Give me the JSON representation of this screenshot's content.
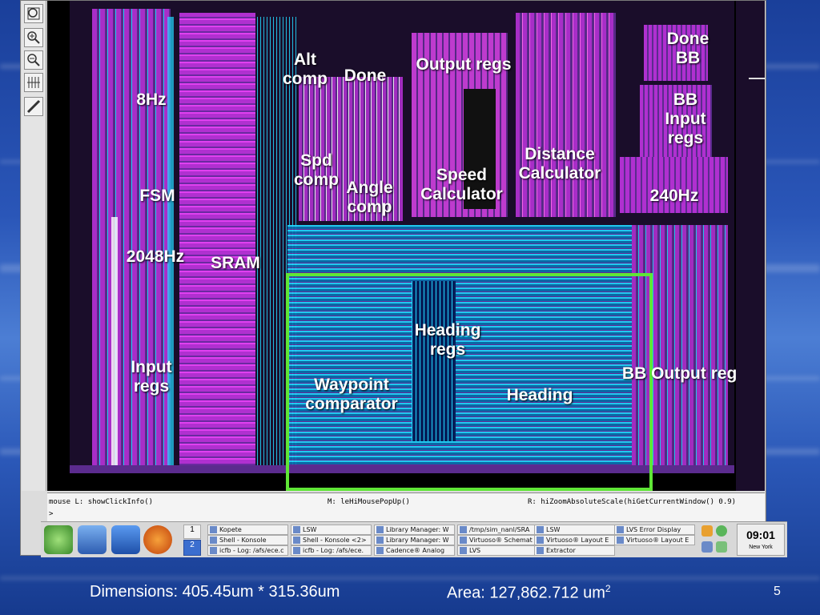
{
  "colors": {
    "magenta": "#b030d0",
    "purple": "#5b2b8e",
    "cyan": "#22d8ff",
    "green_box": "#5fe636"
  },
  "toolbar": {
    "icons": [
      "zoom-fit-icon",
      "zoom-in-icon",
      "zoom-out-icon",
      "stretch-icon",
      "ruler-icon"
    ]
  },
  "layout_labels": {
    "done_bb": "Done\nBB",
    "alt_comp": "Alt\ncomp",
    "done": "Done",
    "output_regs": "Output regs",
    "hz8": "8Hz",
    "bb_input_regs": "BB\nInput\nregs",
    "distance_calc": "Distance\nCalculator",
    "spd_comp": "Spd\ncomp",
    "angle_comp": "Angle\ncomp",
    "speed_calc": "Speed\nCalculator",
    "fsm": "FSM",
    "hz240": "240Hz",
    "hz2048": "2048Hz",
    "sram": "SRAM",
    "heading_regs": "Heading\nregs",
    "input_regs": "Input\nregs",
    "bb_output_regs": "BB Output regs",
    "waypoint_comp": "Waypoint\ncomparator",
    "heading": "Heading"
  },
  "status": {
    "mouse_l": "mouse L: showClickInfo()",
    "mouse_m": "M: leHiMousePopUp()",
    "mouse_r": "R: hiZoomAbsoluteScale(hiGetCurrentWindow() 0.9)",
    "prompt": ">"
  },
  "taskbar": {
    "workspace_1": "1",
    "workspace_2": "2",
    "items": [
      [
        "Kopete",
        "Shell - Konsole",
        "icfb - Log: /afs/ece.c"
      ],
      [
        "LSW",
        "Shell - Konsole <2>",
        "icfb - Log: /afs/ece."
      ],
      [
        "Library Manager: W",
        "Library Manager: W",
        "Cadence® Analog"
      ],
      [
        "/tmp/sim_nanl/SRA",
        "Virtuoso® Schemat",
        "LVS"
      ],
      [
        "LSW",
        "Virtuoso® Layout E",
        "Extractor"
      ],
      [
        "LVS Error Display",
        "Virtuoso® Layout E",
        ""
      ]
    ],
    "clock_time": "09:01",
    "clock_city": "New York"
  },
  "footer": {
    "dimensions": "Dimensions: 405.45um * 315.36um",
    "area": "Area: 127,862.712 um",
    "area_sup": "2",
    "page": "5"
  }
}
